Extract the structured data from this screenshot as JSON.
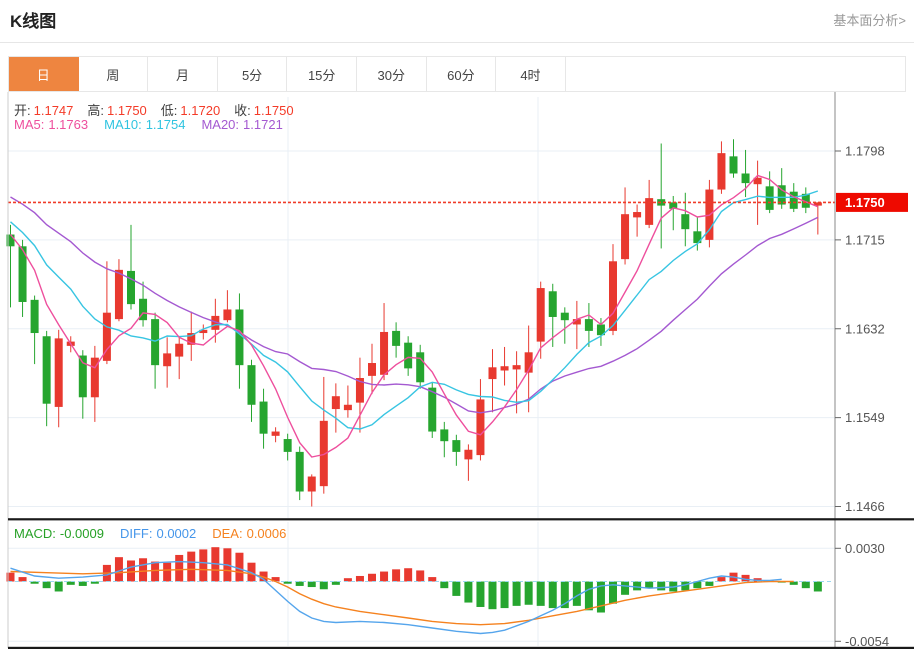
{
  "header": {
    "title": "K线图",
    "link": "基本面分析>"
  },
  "tabs": {
    "items": [
      {
        "label": "日",
        "active": true
      },
      {
        "label": "周",
        "active": false
      },
      {
        "label": "月",
        "active": false
      },
      {
        "label": "5分",
        "active": false
      },
      {
        "label": "15分",
        "active": false
      },
      {
        "label": "30分",
        "active": false
      },
      {
        "label": "60分",
        "active": false
      },
      {
        "label": "4时",
        "active": false
      }
    ]
  },
  "ohlc": {
    "open_label": "开:",
    "open": "1.1747",
    "high_label": "高:",
    "high": "1.1750",
    "low_label": "低:",
    "low": "1.1720",
    "close_label": "收:",
    "close": "1.1750"
  },
  "ma_legend": {
    "ma5_label": "MA5:",
    "ma5": "1.1763",
    "ma10_label": "MA10:",
    "ma10": "1.1754",
    "ma20_label": "MA20:",
    "ma20": "1.1721"
  },
  "macd_legend": {
    "macd_label": "MACD:",
    "macd": "-0.0009",
    "diff_label": "DIFF:",
    "diff": "0.0002",
    "dea_label": "DEA:",
    "dea": "0.0006"
  },
  "colors": {
    "up": "#e8392f",
    "down": "#26a52f",
    "ma5": "#ee4f9d",
    "ma10": "#38c5e2",
    "ma20": "#a459d1",
    "diff": "#55a5ec",
    "dea": "#f5821f",
    "badge": "#ee0a00",
    "last_price_line": "#f03b28",
    "tab_accent": "#ee8540",
    "grid": "#e9eff5",
    "zero_dash": "#9bd7f0"
  },
  "chart_data": {
    "type": "candlestick",
    "title": "K线图",
    "legend": [
      "MA5",
      "MA10",
      "MA20",
      "MACD",
      "DIFF",
      "DEA"
    ],
    "price_axis": {
      "ticks": [
        "1.1798",
        "1.1715",
        "1.1632",
        "1.1549",
        "1.1466"
      ],
      "top_value": 1.1798,
      "bottom_value": 1.1466,
      "last_price_badge": "1.1750"
    },
    "candles": [
      [
        1.172,
        1.1729,
        1.1652,
        1.1709
      ],
      [
        1.1709,
        1.1715,
        1.1643,
        1.1657
      ],
      [
        1.1659,
        1.1663,
        1.1599,
        1.1628
      ],
      [
        1.1625,
        1.163,
        1.1541,
        1.1562
      ],
      [
        1.1559,
        1.1631,
        1.154,
        1.1623
      ],
      [
        1.1616,
        1.1625,
        1.161,
        1.162
      ],
      [
        1.1607,
        1.1612,
        1.1548,
        1.1568
      ],
      [
        1.1568,
        1.1616,
        1.1545,
        1.1605
      ],
      [
        1.1602,
        1.1695,
        1.1599,
        1.1647
      ],
      [
        1.1641,
        1.1697,
        1.1639,
        1.1687
      ],
      [
        1.1686,
        1.1729,
        1.165,
        1.1655
      ],
      [
        1.166,
        1.1676,
        1.1634,
        1.164
      ],
      [
        1.1641,
        1.1647,
        1.1576,
        1.1598
      ],
      [
        1.1597,
        1.1624,
        1.1577,
        1.1609
      ],
      [
        1.1606,
        1.1625,
        1.1585,
        1.1618
      ],
      [
        1.1617,
        1.1648,
        1.1602,
        1.1628
      ],
      [
        1.1628,
        1.1636,
        1.1622,
        1.1631
      ],
      [
        1.1631,
        1.166,
        1.1619,
        1.1644
      ],
      [
        1.164,
        1.1668,
        1.1638,
        1.165
      ],
      [
        1.165,
        1.1665,
        1.1576,
        1.1598
      ],
      [
        1.1598,
        1.1603,
        1.1545,
        1.1561
      ],
      [
        1.1564,
        1.1576,
        1.152,
        1.1534
      ],
      [
        1.1532,
        1.154,
        1.1526,
        1.1536
      ],
      [
        1.1529,
        1.1534,
        1.1509,
        1.1517
      ],
      [
        1.1517,
        1.1522,
        1.1472,
        1.148
      ],
      [
        1.148,
        1.1496,
        1.1466,
        1.1494
      ],
      [
        1.1485,
        1.1587,
        1.1478,
        1.1546
      ],
      [
        1.1557,
        1.1581,
        1.1535,
        1.1569
      ],
      [
        1.1556,
        1.1579,
        1.1549,
        1.1561
      ],
      [
        1.1563,
        1.1605,
        1.1535,
        1.1586
      ],
      [
        1.1588,
        1.1618,
        1.1571,
        1.16
      ],
      [
        1.1589,
        1.1656,
        1.1584,
        1.1629
      ],
      [
        1.163,
        1.1638,
        1.1605,
        1.1616
      ],
      [
        1.1619,
        1.1625,
        1.1588,
        1.1595
      ],
      [
        1.161,
        1.1617,
        1.1576,
        1.1582
      ],
      [
        1.1577,
        1.1582,
        1.153,
        1.1536
      ],
      [
        1.1538,
        1.1545,
        1.1512,
        1.1527
      ],
      [
        1.1528,
        1.1533,
        1.1504,
        1.1517
      ],
      [
        1.151,
        1.1524,
        1.149,
        1.1519
      ],
      [
        1.1514,
        1.1585,
        1.1509,
        1.1566
      ],
      [
        1.1585,
        1.1613,
        1.1554,
        1.1596
      ],
      [
        1.1593,
        1.1615,
        1.1579,
        1.1597
      ],
      [
        1.1594,
        1.1611,
        1.1553,
        1.1598
      ],
      [
        1.1591,
        1.1635,
        1.1554,
        1.161
      ],
      [
        1.162,
        1.1676,
        1.1604,
        1.167
      ],
      [
        1.1667,
        1.1674,
        1.1615,
        1.1643
      ],
      [
        1.1647,
        1.1652,
        1.1618,
        1.164
      ],
      [
        1.1636,
        1.1658,
        1.1613,
        1.1641
      ],
      [
        1.1641,
        1.1656,
        1.1615,
        1.163
      ],
      [
        1.1636,
        1.1642,
        1.1616,
        1.1626
      ],
      [
        1.163,
        1.1711,
        1.1626,
        1.1695
      ],
      [
        1.1697,
        1.1764,
        1.1692,
        1.1739
      ],
      [
        1.1736,
        1.1748,
        1.1718,
        1.1741
      ],
      [
        1.1729,
        1.1771,
        1.1726,
        1.1754
      ],
      [
        1.1753,
        1.1805,
        1.1707,
        1.1747
      ],
      [
        1.175,
        1.1756,
        1.1724,
        1.1744
      ],
      [
        1.1739,
        1.1759,
        1.1709,
        1.1725
      ],
      [
        1.1723,
        1.1736,
        1.1705,
        1.1712
      ],
      [
        1.1715,
        1.1771,
        1.1708,
        1.1762
      ],
      [
        1.1762,
        1.1807,
        1.1758,
        1.1796
      ],
      [
        1.1793,
        1.1809,
        1.1773,
        1.1777
      ],
      [
        1.1777,
        1.1799,
        1.1755,
        1.1768
      ],
      [
        1.1767,
        1.1789,
        1.1729,
        1.1773
      ],
      [
        1.1765,
        1.1779,
        1.174,
        1.1743
      ],
      [
        1.1766,
        1.1782,
        1.1744,
        1.1748
      ],
      [
        1.176,
        1.1768,
        1.1741,
        1.1744
      ],
      [
        1.1758,
        1.1764,
        1.174,
        1.1745
      ],
      [
        1.1747,
        1.175,
        1.172,
        1.175
      ]
    ],
    "ma_seed_closes": [
      1.179,
      1.1788,
      1.1785,
      1.1782,
      1.178,
      1.1778,
      1.1775,
      1.1772,
      1.1768,
      1.1763,
      1.1757,
      1.175,
      1.1743,
      1.1737,
      1.1732,
      1.1728,
      1.1724,
      1.1721,
      1.1718
    ],
    "macd": {
      "axis_ticks": [
        "0.0030",
        "-0.0054"
      ],
      "top_value": 0.003,
      "bottom_value": -0.0054,
      "hist": [
        0.0008,
        0.0004,
        -0.0002,
        -0.0006,
        -0.0009,
        -0.0003,
        -0.0004,
        -0.0002,
        0.0015,
        0.0022,
        0.0019,
        0.0021,
        0.0018,
        0.0017,
        0.0024,
        0.0027,
        0.0029,
        0.0031,
        0.003,
        0.0026,
        0.0017,
        0.0009,
        0.0004,
        -0.0002,
        -0.0004,
        -0.0005,
        -0.0007,
        -0.0003,
        0.0003,
        0.0005,
        0.0007,
        0.0009,
        0.0011,
        0.0012,
        0.001,
        0.0004,
        -0.0006,
        -0.0013,
        -0.0019,
        -0.0023,
        -0.0025,
        -0.0024,
        -0.0022,
        -0.0021,
        -0.0022,
        -0.0024,
        -0.0024,
        -0.0022,
        -0.0026,
        -0.0028,
        -0.002,
        -0.0012,
        -0.0008,
        -0.0006,
        -0.0008,
        -0.0009,
        -0.0008,
        -0.0006,
        -0.0004,
        0.0004,
        0.0008,
        0.0006,
        0.0003,
        0.0001,
        -0.0001,
        -0.0003,
        -0.0006,
        -0.0009
      ],
      "diff_line": [
        [
          1,
          0.0012
        ],
        [
          3,
          0.0005
        ],
        [
          5,
          0.0003
        ],
        [
          7,
          0.0004
        ],
        [
          9,
          0.0006
        ],
        [
          11,
          0.0013
        ],
        [
          13,
          0.0017
        ],
        [
          15,
          0.0018
        ],
        [
          17,
          0.0017
        ],
        [
          19,
          0.0015
        ],
        [
          21,
          0.0008
        ],
        [
          22,
          0.0002
        ],
        [
          23,
          -0.0008
        ],
        [
          24,
          -0.0018
        ],
        [
          25,
          -0.0027
        ],
        [
          26,
          -0.0033
        ],
        [
          27,
          -0.0036
        ],
        [
          28,
          -0.0037
        ],
        [
          30,
          -0.0036
        ],
        [
          32,
          -0.0037
        ],
        [
          34,
          -0.0039
        ],
        [
          36,
          -0.0042
        ],
        [
          38,
          -0.0045
        ],
        [
          40,
          -0.0047
        ],
        [
          41,
          -0.0046
        ],
        [
          42,
          -0.0044
        ],
        [
          43,
          -0.004
        ],
        [
          44,
          -0.0036
        ],
        [
          45,
          -0.0031
        ],
        [
          46,
          -0.0026
        ],
        [
          47,
          -0.002
        ],
        [
          48,
          -0.0013
        ],
        [
          49,
          -0.0007
        ],
        [
          50,
          -0.0004
        ],
        [
          51,
          -0.0003
        ],
        [
          52,
          -0.0004
        ],
        [
          54,
          -0.0006
        ],
        [
          56,
          -0.0005
        ],
        [
          57,
          -0.0003
        ],
        [
          58,
          0.0
        ],
        [
          59,
          0.0003
        ],
        [
          60,
          0.0005
        ],
        [
          61,
          0.0004
        ],
        [
          62,
          0.0002
        ],
        [
          63,
          0.0001
        ],
        [
          64,
          0.0001
        ],
        [
          65,
          0.0002
        ]
      ],
      "dea_line": [
        [
          1,
          0.0009
        ],
        [
          4,
          0.0008
        ],
        [
          7,
          0.0007
        ],
        [
          10,
          0.0008
        ],
        [
          13,
          0.001
        ],
        [
          16,
          0.0011
        ],
        [
          19,
          0.001
        ],
        [
          21,
          0.0007
        ],
        [
          22,
          0.0004
        ],
        [
          23,
          0.0
        ],
        [
          24,
          -0.0005
        ],
        [
          25,
          -0.0011
        ],
        [
          26,
          -0.0016
        ],
        [
          27,
          -0.002
        ],
        [
          28,
          -0.0023
        ],
        [
          30,
          -0.0027
        ],
        [
          32,
          -0.003
        ],
        [
          34,
          -0.0033
        ],
        [
          36,
          -0.0036
        ],
        [
          38,
          -0.0038
        ],
        [
          40,
          -0.0039
        ],
        [
          42,
          -0.0038
        ],
        [
          44,
          -0.0035
        ],
        [
          46,
          -0.0031
        ],
        [
          48,
          -0.0027
        ],
        [
          50,
          -0.0022
        ],
        [
          52,
          -0.0017
        ],
        [
          54,
          -0.0013
        ],
        [
          56,
          -0.001
        ],
        [
          58,
          -0.0007
        ],
        [
          60,
          -0.0004
        ],
        [
          62,
          -0.0001
        ],
        [
          64,
          0.0
        ],
        [
          66,
          0.0
        ]
      ]
    }
  }
}
